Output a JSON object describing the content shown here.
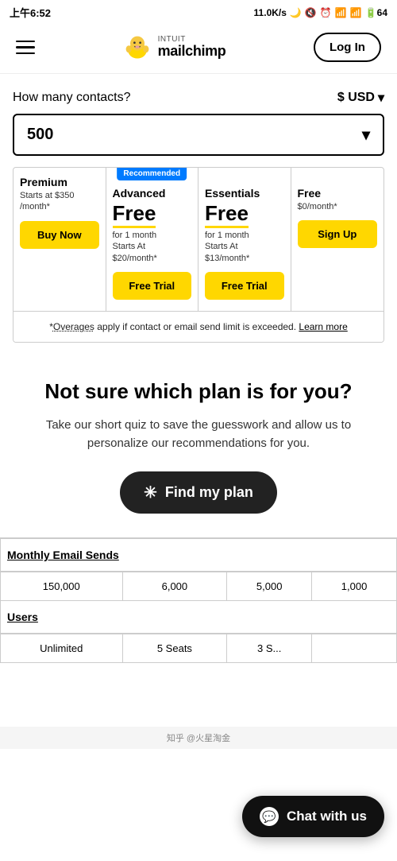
{
  "statusBar": {
    "time": "上午6:52",
    "network": "11.0K/s",
    "battery": "64"
  },
  "header": {
    "loginLabel": "Log In",
    "intuitLabel": "INTUIT",
    "mailchimpLabel": "mailchimp"
  },
  "contacts": {
    "label": "How many contacts?",
    "currencyLabel": "$ USD",
    "value": "500",
    "dropdownArrow": "▾"
  },
  "recommended": {
    "badge": "Recommended"
  },
  "plans": [
    {
      "name": "Premium",
      "starts": "Starts at $350\n/month*",
      "priceFree": null,
      "priceDetail": null,
      "btnLabel": "Buy Now",
      "btnType": "buy-now"
    },
    {
      "name": "Advanced",
      "starts": null,
      "priceFree": "Free",
      "priceDetail": "for 1 month\nStarts At\n$20/month*",
      "btnLabel": "Free Trial",
      "btnType": "free-trial",
      "recommended": true
    },
    {
      "name": "Essentials",
      "starts": null,
      "priceFree": "Free",
      "priceDetail": "for 1 month\nStarts At\n$13/month*",
      "btnLabel": "Free Trial",
      "btnType": "free-trial"
    },
    {
      "name": "Free",
      "starts": "$0/month*",
      "priceFree": null,
      "priceDetail": null,
      "btnLabel": "Sign Up",
      "btnType": "sign-up"
    }
  ],
  "overages": {
    "text": "*Overages apply if contact or email send limit is exceeded.",
    "linkText": "Learn more",
    "overagesUnderlineText": "Overages"
  },
  "quiz": {
    "title": "Not sure which plan is for you?",
    "description": "Take our short quiz to save the guesswork and allow us to personalize our recommendations for you.",
    "buttonLabel": "Find my plan"
  },
  "comparisonTable": {
    "sections": [
      {
        "header": "Monthly Email Sends",
        "rows": [
          {
            "values": [
              "150,000",
              "6,000",
              "5,000",
              "1,000"
            ]
          }
        ]
      },
      {
        "header": "Users",
        "rows": [
          {
            "values": [
              "Unlimited",
              "5 Seats",
              "3 S...",
              ""
            ]
          }
        ]
      }
    ]
  },
  "chat": {
    "label": "Chat with us"
  },
  "bottomBar": {
    "text": "知乎 @火星淘金"
  }
}
